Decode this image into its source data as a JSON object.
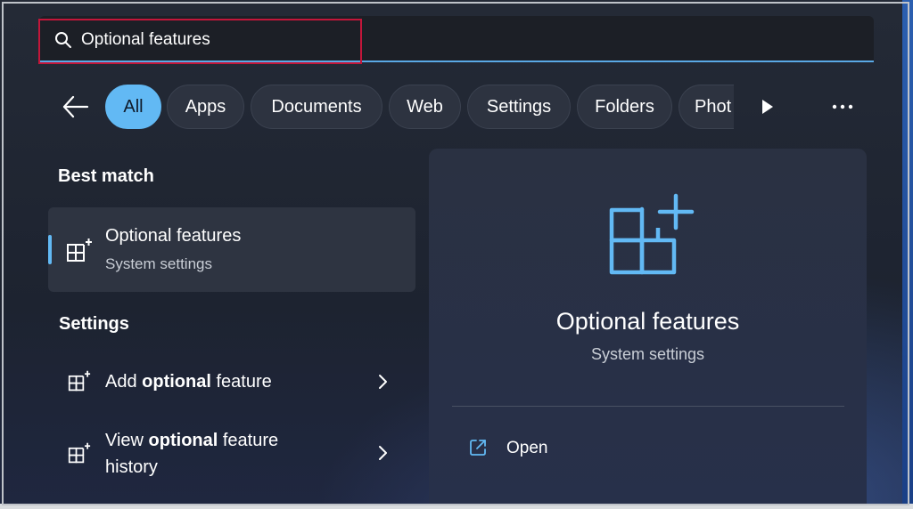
{
  "search": {
    "value": "Optional features",
    "icon": "search-icon"
  },
  "filters": {
    "back_icon": "arrow-left-icon",
    "chips": [
      {
        "label": "All",
        "active": true
      },
      {
        "label": "Apps",
        "active": false
      },
      {
        "label": "Documents",
        "active": false
      },
      {
        "label": "Web",
        "active": false
      },
      {
        "label": "Settings",
        "active": false
      },
      {
        "label": "Folders",
        "active": false
      },
      {
        "label": "Phot",
        "active": false
      }
    ],
    "scroll_icon": "play-icon",
    "more_icon": "more-horizontal-icon"
  },
  "best_match": {
    "heading": "Best match",
    "item": {
      "icon": "optional-features-icon",
      "title": "Optional features",
      "subtitle": "System settings"
    }
  },
  "settings": {
    "heading": "Settings",
    "items": [
      {
        "icon": "optional-features-icon",
        "prefix": "Add ",
        "bold": "optional",
        "suffix": " feature",
        "line2": ""
      },
      {
        "icon": "optional-features-icon",
        "prefix": "View ",
        "bold": "optional",
        "suffix": " feature",
        "line2": "history"
      }
    ]
  },
  "preview": {
    "icon": "optional-features-icon",
    "title": "Optional features",
    "subtitle": "System settings",
    "actions": [
      {
        "icon": "open-external-icon",
        "label": "Open"
      }
    ]
  },
  "colors": {
    "accent": "#62b9f4",
    "highlight_border": "#c3163a",
    "background": "#1d2330"
  }
}
